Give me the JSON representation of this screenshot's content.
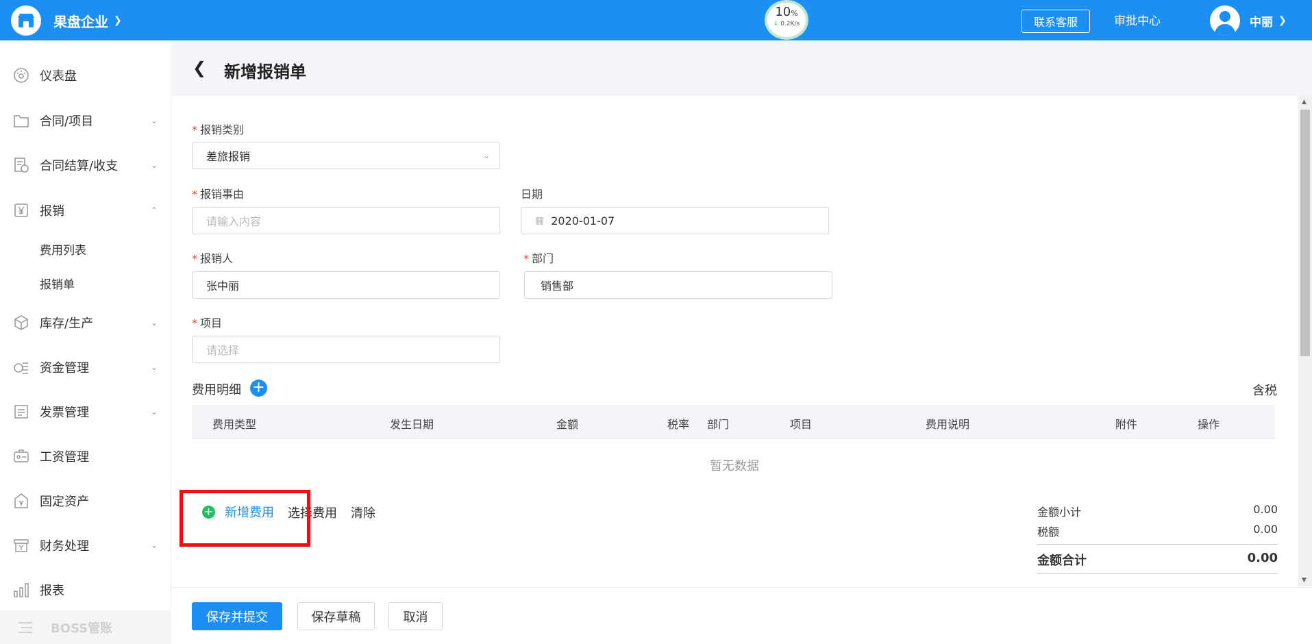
{
  "header": {
    "company": "果盘企业",
    "speed_percent": "10",
    "speed_percent_unit": "%",
    "speed_rate": "0.2K/s",
    "service_button": "联系客服",
    "approval_center": "审批中心",
    "user_name": "中丽",
    "brand_color": "#1c8ff2"
  },
  "sidebar": {
    "items": [
      {
        "label": "仪表盘",
        "icon": "dashboard-icon"
      },
      {
        "label": "合同/项目",
        "icon": "folder-icon"
      },
      {
        "label": "合同结算/收支",
        "icon": "settlement-icon"
      },
      {
        "label": "报销",
        "icon": "yuan-icon"
      },
      {
        "label": "库存/生产",
        "icon": "cube-icon"
      },
      {
        "label": "资金管理",
        "icon": "fund-icon"
      },
      {
        "label": "发票管理",
        "icon": "invoice-icon"
      },
      {
        "label": "工资管理",
        "icon": "salary-icon"
      },
      {
        "label": "固定资产",
        "icon": "asset-icon"
      },
      {
        "label": "财务处理",
        "icon": "finance-icon"
      },
      {
        "label": "报表",
        "icon": "bar-chart-icon"
      },
      {
        "label": "BOSS管账",
        "icon": "menu-icon"
      }
    ],
    "sub_items": [
      "费用列表",
      "报销单"
    ]
  },
  "page": {
    "title": "新增报销单"
  },
  "form": {
    "category_label": "报销类别",
    "category_value": "差旅报销",
    "reason_label": "报销事由",
    "reason_placeholder": "请输入内容",
    "date_label": "日期",
    "date_value": "2020-01-07",
    "person_label": "报销人",
    "person_value": "张中丽",
    "dept_label": "部门",
    "dept_value": "销售部",
    "project_label": "项目",
    "project_placeholder": "请选择",
    "required_mark": "*"
  },
  "details": {
    "title": "费用明细",
    "tax_toggle": "含税",
    "columns": [
      "费用类型",
      "发生日期",
      "金额",
      "税率",
      "部门",
      "项目",
      "费用说明",
      "附件",
      "操作"
    ],
    "empty_text": "暂无数据",
    "add_fee": "新增费用",
    "select_fee": "选择费用",
    "clear": "清除"
  },
  "summary": {
    "subtotal_label": "金额小计",
    "subtotal_value": "0.00",
    "tax_label": "税额",
    "tax_value": "0.00",
    "total_label": "金额合计",
    "total_value": "0.00"
  },
  "footer": {
    "submit": "保存并提交",
    "draft": "保存草稿",
    "cancel": "取消"
  }
}
